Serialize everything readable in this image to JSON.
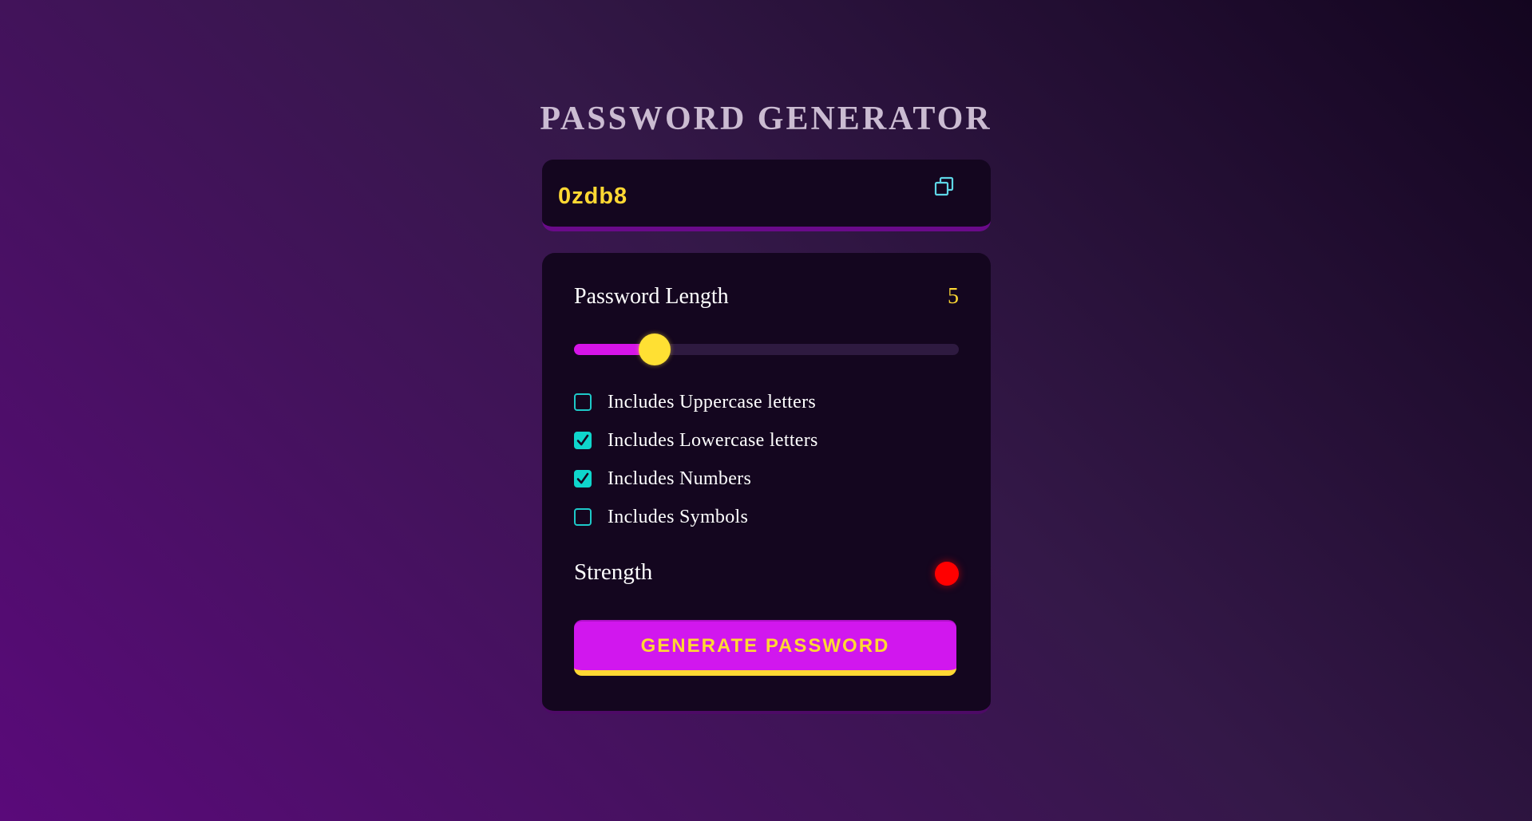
{
  "app": {
    "title": "PASSWORD GENERATOR"
  },
  "display": {
    "password": "0zdb8",
    "copy_icon": "copy-icon"
  },
  "settings": {
    "length_label": "Password Length",
    "length_value": "5",
    "slider": {
      "min": 1,
      "max": 20,
      "value": 5
    },
    "options": [
      {
        "label": "Includes Uppercase letters",
        "checked": false
      },
      {
        "label": "Includes Lowercase letters",
        "checked": true
      },
      {
        "label": "Includes Numbers",
        "checked": true
      },
      {
        "label": "Includes Symbols",
        "checked": false
      }
    ],
    "strength_label": "Strength",
    "strength_color": "#ff0000"
  },
  "actions": {
    "generate_label": "GENERATE PASSWORD"
  },
  "colors": {
    "accent_yellow": "#ffd833",
    "accent_magenta": "#d117ee",
    "accent_teal": "#0fd6cc",
    "panel_bg": "#14061f"
  }
}
